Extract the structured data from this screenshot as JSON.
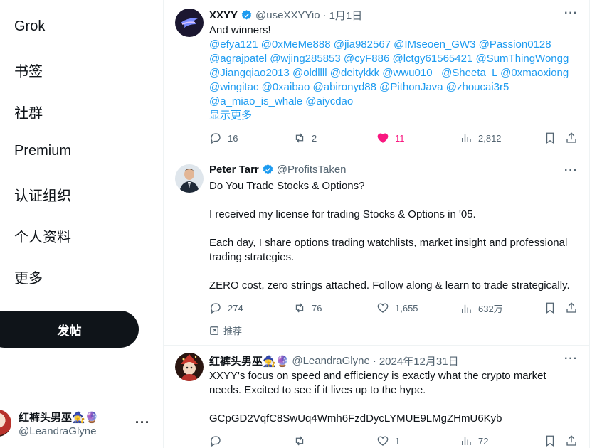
{
  "sidebar": {
    "items": [
      {
        "label": "Grok"
      },
      {
        "label": "书签"
      },
      {
        "label": "社群"
      },
      {
        "label": "Premium"
      },
      {
        "label": "认证组织"
      },
      {
        "label": "个人资料"
      },
      {
        "label": "更多"
      }
    ],
    "post_label": "发帖",
    "account": {
      "name": "红裤头男巫🧙‍♀️🔮",
      "handle": "@LeandraGlyne",
      "more": "···"
    }
  },
  "tweets": [
    {
      "name": "XXYY",
      "handle": "@useXXYYio",
      "dot": "·",
      "time": "1月1日",
      "lines": [
        "And winners!",
        "@efya121 @0xMeMe888 @jia982567 @IMseoen_GW3 @Passion0128",
        "@agrajpatel @wjing285853 @cyF886 @lctgy61565421 @SumThingWongg",
        "@Jiangqiao2013 @oldllll @deitykkk @wwu010_ @Sheeta_L @0xmaoxiong",
        "@wingitac @0xaibao @abironyd88 @PithonJava @zhoucai3r5",
        "@a_miao_is_whale @aiycdao"
      ],
      "show_more": "显示更多",
      "replies": "16",
      "reposts": "2",
      "likes": "11",
      "views": "2,812"
    },
    {
      "name": "Peter Tarr",
      "handle": "@ProfitsTaken",
      "paragraphs": [
        "Do You Trade Stocks & Options?",
        "I received my license for trading Stocks & Options in '05.",
        "Each day, I share options trading watchlists, market insight and professional trading strategies.",
        "ZERO cost, zero strings attached. Follow along & learn to trade strategically."
      ],
      "replies": "274",
      "reposts": "76",
      "likes": "1,655",
      "views": "632万",
      "promoted": "推荐"
    },
    {
      "name": "红裤头男巫🧙‍♀️🔮",
      "handle": "@LeandraGlyne",
      "dot": "·",
      "time": "2024年12月31日",
      "paragraphs": [
        "XXYY's focus on speed and efficiency is exactly what the crypto market needs. Excited to see if it lives up to the hype.",
        "GCpGD2VqfC8SwUq4Wmh6FzdDycLYMUE9LMgZHmU6Kyb"
      ],
      "replies": "",
      "reposts": "",
      "likes": "1",
      "views": "72"
    }
  ],
  "colors": {
    "accent": "#1d9bf0",
    "like": "#f91880",
    "text": "#0f1419",
    "muted": "#536471",
    "verified": "#1d9bf0"
  }
}
